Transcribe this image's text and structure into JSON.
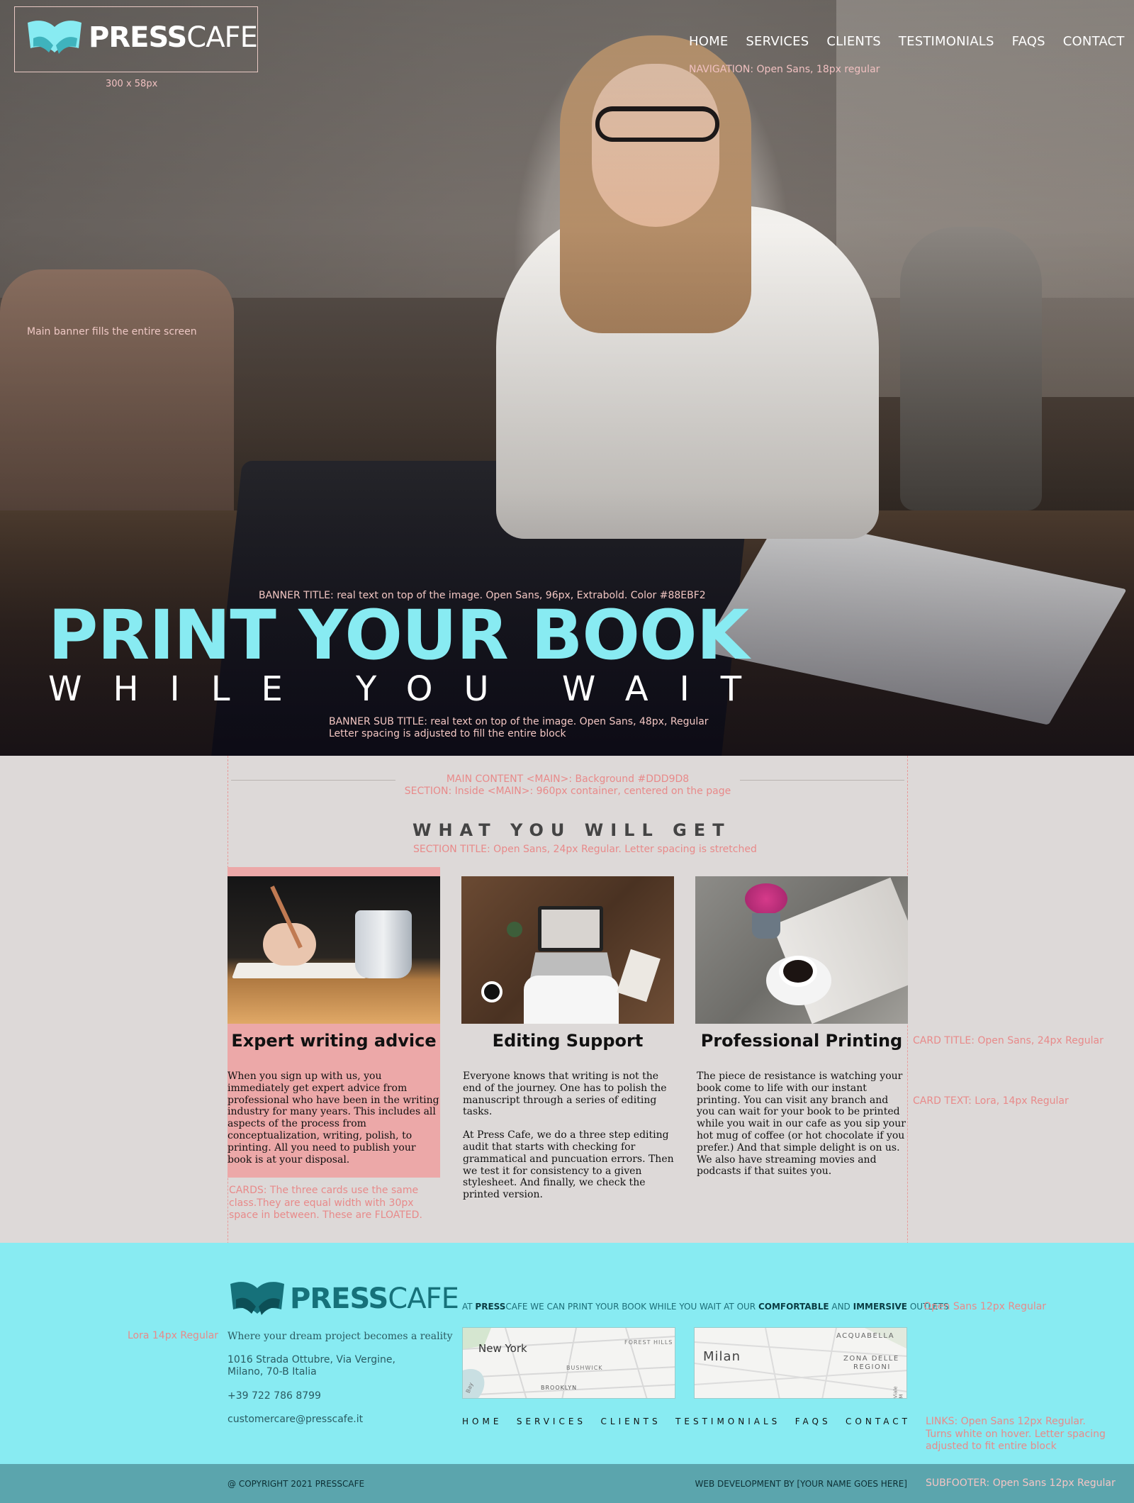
{
  "brand": {
    "name_bold": "PRESS",
    "name_light": "CAFE",
    "logo_size_note": "300 x 58px"
  },
  "nav": {
    "items": [
      "HOME",
      "SERVICES",
      "CLIENTS",
      "TESTIMONIALS",
      "FAQS",
      "CONTACT"
    ],
    "note": "NAVIGATION: Open Sans, 18px regular"
  },
  "hero": {
    "note_fill": "Main banner fills the entire screen",
    "note_title": "BANNER TITLE: real text on top of the image. Open Sans, 96px, Extrabold. Color #88EBF2",
    "title": "PRINT YOUR BOOK",
    "subtitle": "WHILE YOU WAIT",
    "note_sub_1": "BANNER SUB TITLE: real text on top of the image. Open Sans, 48px, Regular",
    "note_sub_2": "Letter spacing is adjusted to fill the entire block"
  },
  "main": {
    "note_main": "MAIN CONTENT <MAIN>: Background #DDD9D8",
    "note_section": "SECTION: Inside <MAIN>: 960px container, centered on the page",
    "section_title": "WHAT YOU WILL GET",
    "note_section_title": "SECTION TITLE: Open Sans, 24px Regular. Letter spacing is stretched",
    "note_card_title": "CARD TITLE: Open Sans, 24px Regular",
    "note_card_text": "CARD TEXT: Lora, 14px Regular",
    "note_cards": "CARDS: The three cards use the same class.They are equal width with 30px space in between. These are FLOATED.",
    "cards": [
      {
        "title": "Expert writing advice",
        "paragraphs": [
          "When you sign up with us, you immediately get expert advice from professional who have been in the writing industry for many years. This includes all aspects of the process from conceptualization, writing, polish, to printing. All you need to publish your book is at your disposal."
        ]
      },
      {
        "title": "Editing Support",
        "paragraphs": [
          "Everyone knows that writing is not the end of the journey. One has to polish the manuscript through a series of editing tasks.",
          "At Press Cafe, we do a three step editing audit that starts with checking for grammatical and puncuation errors. Then we test it for consistency to a given stylesheet. And finally, we check the printed version."
        ]
      },
      {
        "title": "Professional Printing",
        "paragraphs": [
          "The piece de resistance is watching your book come to life with our instant printing. You can visit any branch and you can wait for your book to be printed while you wait in our cafe as you sip your hot mug of coffee (or hot chocolate if you prefer.) And that simple delight is on us. We also have streaming movies and podcasts if that suites you."
        ]
      }
    ]
  },
  "footer": {
    "tagline": "Where your dream project becomes a reality",
    "address_1": "1016 Strada Ottubre, Via Vergine,",
    "address_2": "Milano, 70-B Italia",
    "phone": "+39 722 786 8799",
    "email": "customercare@presscafe.it",
    "note_lora": "Lora 14px Regular",
    "note_opensans": "Open Sans 12px Regular",
    "outlets": {
      "p1": "AT ",
      "b1": "PRESS",
      "p2": "CAFE WE CAN PRINT YOUR  BOOK WHILE YOU WAIT AT OUR ",
      "b2": "COMFORTABLE",
      "p3": " AND ",
      "b3": "IMMERSIVE",
      "p4": " OUTLETS"
    },
    "maps": [
      {
        "city": "New York",
        "labels": [
          "FOREST HILLS",
          "BUSHWICK",
          "BROOKLYN",
          "Bay"
        ]
      },
      {
        "city": "Milan",
        "labels": [
          "ACQUABELLA",
          "ZONA DELLE",
          "REGIONI",
          "Viale M"
        ]
      }
    ],
    "links": [
      "HOME",
      "SERVICES",
      "CLIENTS",
      "TESTIMONIALS",
      "FAQS",
      "CONTACT"
    ],
    "note_links": "LINKS: Open Sans 12px Regular. Turns white on hover. Letter spacing adjusted to fit entire block"
  },
  "subfooter": {
    "copyright": "@ COPYRIGHT 2021 PRESSCAFE",
    "credit": "WEB DEVELOPMENT BY [YOUR NAME GOES HERE]",
    "note": "SUBFOOTER: Open Sans 12px Regular"
  },
  "colors": {
    "accent": "#88EBF2",
    "main_bg": "#DDD9D8",
    "annotation": "#E88A8A",
    "highlight_card": "#ECA8A8",
    "subfooter": "#5BA5AD",
    "logo_dark": "#16717A"
  }
}
